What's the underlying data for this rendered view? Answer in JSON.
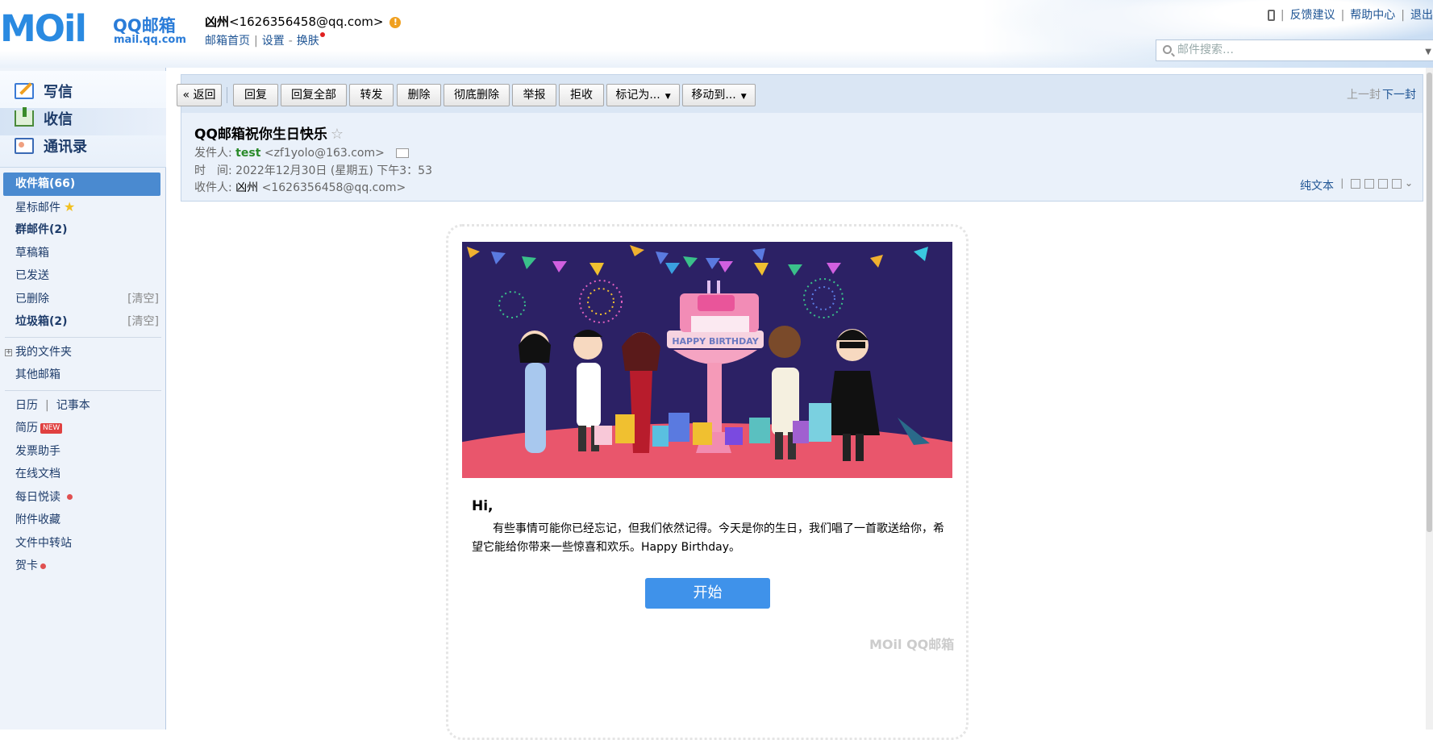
{
  "header": {
    "logo_text": "MOil",
    "logo_brand": "QQ邮箱",
    "logo_url": "mail.qq.com",
    "account_name": "凶州",
    "account_email": "<1626356458@qq.com>",
    "links": {
      "home": "邮箱首页",
      "settings": "设置",
      "skin": "换肤"
    },
    "top_links": {
      "feedback": "反馈建议",
      "help": "帮助中心",
      "logout": "退出"
    },
    "search_placeholder": "邮件搜索…"
  },
  "sidebar": {
    "write": "写信",
    "receive": "收信",
    "contacts": "通讯录",
    "folders": {
      "inbox": "收件箱(66)",
      "starred": "星标邮件",
      "group": "群邮件(2)",
      "drafts": "草稿箱",
      "sent": "已发送",
      "deleted": "已删除",
      "deleted_clear": "[清空]",
      "spam": "垃圾箱(2)",
      "spam_clear": "[清空]",
      "my_folders": "我的文件夹",
      "other_mail": "其他邮箱"
    },
    "tools": {
      "calendar": "日历",
      "notes": "记事本",
      "resume": "简历",
      "resume_badge": "NEW",
      "invoice": "发票助手",
      "docs": "在线文档",
      "daily": "每日悦读",
      "attachments": "附件收藏",
      "transfer": "文件中转站",
      "cards": "贺卡"
    }
  },
  "toolbar": {
    "back": "« 返回",
    "reply": "回复",
    "reply_all": "回复全部",
    "forward": "转发",
    "delete": "删除",
    "delete_perm": "彻底删除",
    "report": "举报",
    "reject": "拒收",
    "mark_as": "标记为...",
    "move_to": "移动到...",
    "prev": "上一封",
    "next": "下一封"
  },
  "mail": {
    "subject": "QQ邮箱祝你生日快乐",
    "from_label": "发件人:",
    "from_name": "test",
    "from_email": "<zf1yolo@163.com>",
    "time_label": "时　间:",
    "time_value": "2022年12月30日 (星期五) 下午3：53",
    "to_label": "收件人:",
    "to_name": "凶州",
    "to_email": "<1626356458@qq.com>",
    "plain_text": "纯文本",
    "greeting": "Hi,",
    "body": "有些事情可能你已经忘记，但我们依然记得。今天是你的生日，我们唱了一首歌送给你，希望它能给你带来一些惊喜和欢乐。Happy Birthday。",
    "start_button": "开始",
    "banner_text": "HAPPY BIRTHDAY",
    "footer_logo": "MOil QQ邮箱"
  },
  "colors": {
    "accent": "#4a8ad0",
    "banner_bg": "#2c2165",
    "start_button": "#3f92ea",
    "sender_green": "#2a8a2a"
  }
}
